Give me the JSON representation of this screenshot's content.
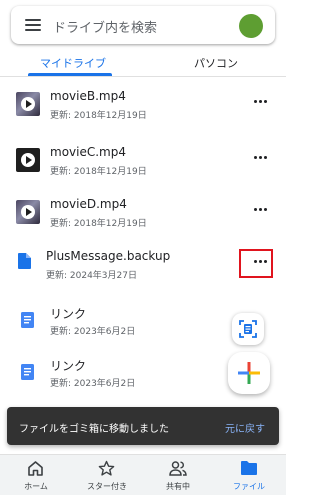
{
  "search": {
    "placeholder": "ドライブ内を検索"
  },
  "tabs": [
    {
      "label": "マイドライブ",
      "active": true
    },
    {
      "label": "パソコン",
      "active": false
    }
  ],
  "files": [
    {
      "name": "movieB.mp4",
      "modified": "更新: 2018年12月19日",
      "icon": "video-thumbnail-icon"
    },
    {
      "name": "movieC.mp4",
      "modified": "更新: 2018年12月19日",
      "icon": "video-play-icon"
    },
    {
      "name": "movieD.mp4",
      "modified": "更新: 2018年12月19日",
      "icon": "video-thumbnail-icon"
    },
    {
      "name": "PlusMessage.backup",
      "modified": "更新: 2024年3月27日",
      "icon": "file-icon"
    },
    {
      "name": "リンク",
      "modified": "更新: 2023年6月2日",
      "icon": "doc-icon"
    },
    {
      "name": "リンク",
      "modified": "更新: 2023年6月2日",
      "icon": "doc-icon"
    }
  ],
  "snackbar": {
    "message": "ファイルをゴミ箱に移動しました",
    "action": "元に戻す"
  },
  "bottom_nav": [
    {
      "label": "ホーム",
      "icon": "home-icon",
      "active": false
    },
    {
      "label": "スター付き",
      "icon": "star-icon",
      "active": false
    },
    {
      "label": "共有中",
      "icon": "people-icon",
      "active": false
    },
    {
      "label": "ファイル",
      "icon": "folder-icon",
      "active": true
    }
  ],
  "colors": {
    "accent": "#1a73e8",
    "avatar": "#5e9e32",
    "highlight_box": "#e0141e",
    "snackbar_bg": "#323232",
    "snackbar_action": "#8ab4f8"
  }
}
